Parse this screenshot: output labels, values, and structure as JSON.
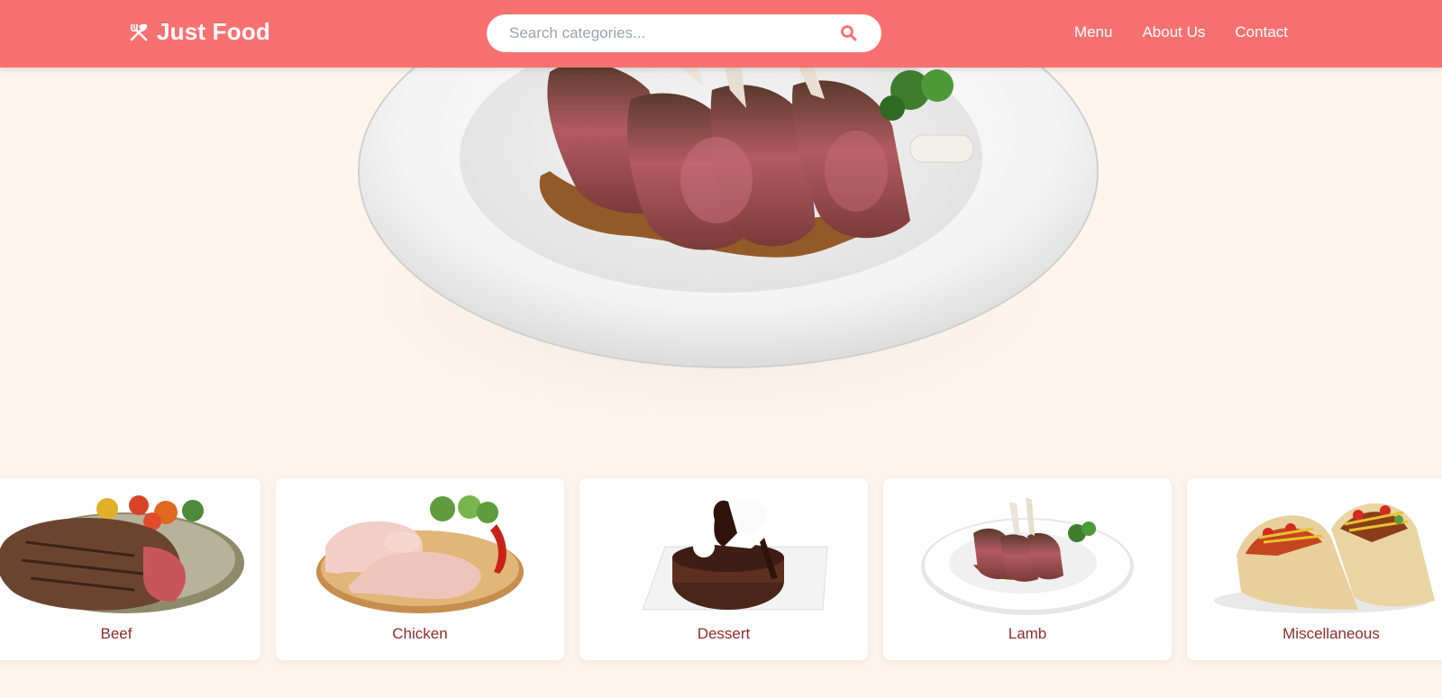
{
  "brand": {
    "name": "Just Food",
    "icon": "utensils-icon"
  },
  "search": {
    "placeholder": "Search categories...",
    "value": "",
    "button_icon": "search-icon"
  },
  "nav": {
    "items": [
      "Menu",
      "About Us",
      "Contact"
    ]
  },
  "hero": {
    "image": "lamb-chops-plate"
  },
  "categories": [
    {
      "label": "Beef",
      "image": "grilled-steak"
    },
    {
      "label": "Chicken",
      "image": "raw-chicken-legs"
    },
    {
      "label": "Dessert",
      "image": "chocolate-lava-cake"
    },
    {
      "label": "Lamb",
      "image": "lamb-chops"
    },
    {
      "label": "Miscellaneous",
      "image": "tacos"
    }
  ],
  "colors": {
    "header": "#f87171",
    "page_background": "#fdf4ec",
    "category_label": "#8b2c2c",
    "card_background": "#ffffff"
  }
}
